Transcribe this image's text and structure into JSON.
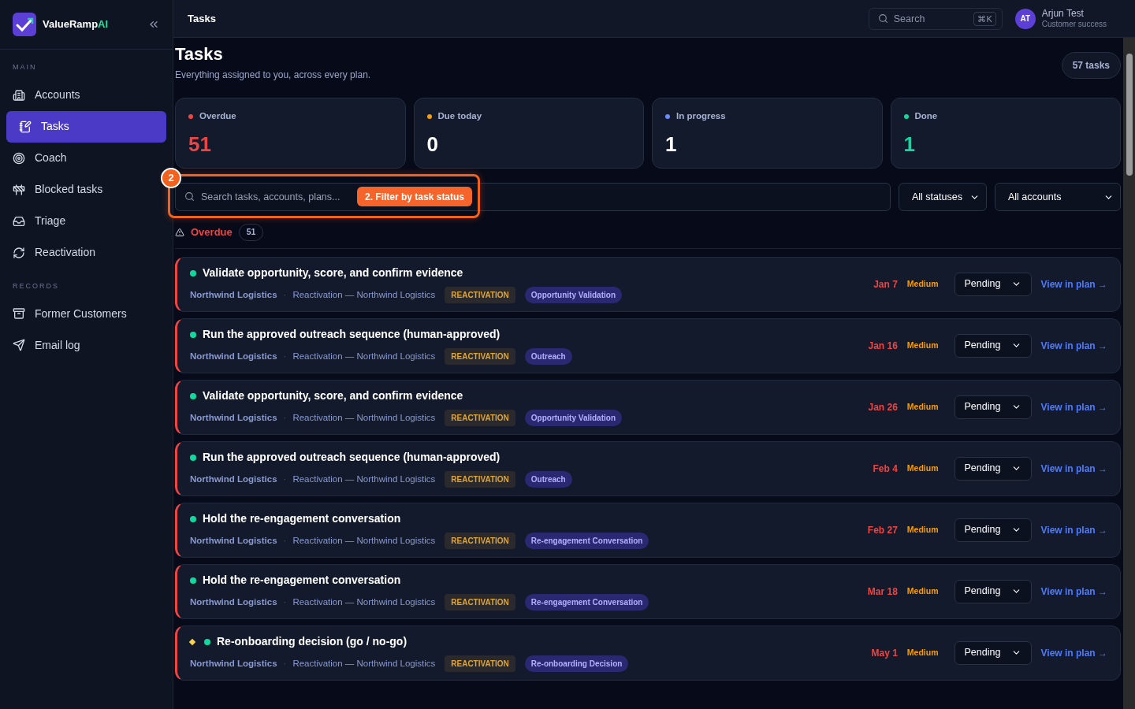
{
  "sidebar": {
    "brand": {
      "name": "ValueRamp",
      "accent": "AI"
    },
    "sections": [
      {
        "label": "MAIN",
        "items": [
          {
            "label": "Accounts",
            "selected": false
          },
          {
            "label": "Tasks",
            "selected": true
          },
          {
            "label": "Coach",
            "selected": false
          },
          {
            "label": "Blocked tasks",
            "selected": false
          },
          {
            "label": "Triage",
            "selected": false
          },
          {
            "label": "Reactivation",
            "selected": false
          }
        ]
      },
      {
        "label": "RECORDS",
        "items": [
          {
            "label": "Former Customers",
            "selected": false
          },
          {
            "label": "Email log",
            "selected": false
          }
        ]
      }
    ]
  },
  "header": {
    "title": "Tasks",
    "search": {
      "placeholder": "Search",
      "shortcut": "⌘K"
    },
    "user": {
      "initials": "AT",
      "name": "Arjun Test",
      "role": "Customer success"
    }
  },
  "page": {
    "title": "Tasks",
    "subtitle": "Everything assigned to you, across every plan.",
    "count": "57 tasks"
  },
  "stats": [
    {
      "label": "Overdue",
      "value": "51",
      "color": "#ef4444"
    },
    {
      "label": "Due today",
      "value": "0",
      "color": "#f59e0b"
    },
    {
      "label": "In progress",
      "value": "1",
      "color": "#6b8cff"
    },
    {
      "label": "Done",
      "value": "1",
      "color": "#10d9a0"
    }
  ],
  "filters": {
    "search": {
      "placeholder": "Search tasks, accounts, plans..."
    },
    "status": "All statuses",
    "account": "All accounts"
  },
  "tour": {
    "step": "2",
    "label": "2. Filter by task status"
  },
  "group": {
    "label": "Overdue",
    "count": "51"
  },
  "rows": [
    {
      "title": "Validate opportunity, score, and confirm evidence",
      "flagged": false,
      "account": "Northwind Logistics",
      "separator": "·",
      "plan": "Reactivation — Northwind Logistics",
      "tag": "REACTIVATION",
      "category": "Opportunity Validation",
      "due": "Jan 7",
      "priority": "Medium",
      "status": "Pending",
      "link": "View in plan →"
    },
    {
      "title": "Run the approved outreach sequence (human-approved)",
      "flagged": false,
      "account": "Northwind Logistics",
      "separator": "·",
      "plan": "Reactivation — Northwind Logistics",
      "tag": "REACTIVATION",
      "category": "Outreach",
      "due": "Jan 16",
      "priority": "Medium",
      "status": "Pending",
      "link": "View in plan →"
    },
    {
      "title": "Validate opportunity, score, and confirm evidence",
      "flagged": false,
      "account": "Northwind Logistics",
      "separator": "·",
      "plan": "Reactivation — Northwind Logistics",
      "tag": "REACTIVATION",
      "category": "Opportunity Validation",
      "due": "Jan 26",
      "priority": "Medium",
      "status": "Pending",
      "link": "View in plan →"
    },
    {
      "title": "Run the approved outreach sequence (human-approved)",
      "flagged": false,
      "account": "Northwind Logistics",
      "separator": "·",
      "plan": "Reactivation — Northwind Logistics",
      "tag": "REACTIVATION",
      "category": "Outreach",
      "due": "Feb 4",
      "priority": "Medium",
      "status": "Pending",
      "link": "View in plan →"
    },
    {
      "title": "Hold the re-engagement conversation",
      "flagged": false,
      "account": "Northwind Logistics",
      "separator": "·",
      "plan": "Reactivation — Northwind Logistics",
      "tag": "REACTIVATION",
      "category": "Re-engagement Conversation",
      "due": "Feb 27",
      "priority": "Medium",
      "status": "Pending",
      "link": "View in plan →"
    },
    {
      "title": "Hold the re-engagement conversation",
      "flagged": false,
      "account": "Northwind Logistics",
      "separator": "·",
      "plan": "Reactivation — Northwind Logistics",
      "tag": "REACTIVATION",
      "category": "Re-engagement Conversation",
      "due": "Mar 18",
      "priority": "Medium",
      "status": "Pending",
      "link": "View in plan →"
    },
    {
      "title": "Re-onboarding decision (go / no-go)",
      "flagged": true,
      "account": "Northwind Logistics",
      "separator": "·",
      "plan": "Reactivation — Northwind Logistics",
      "tag": "REACTIVATION",
      "category": "Re-onboarding Decision",
      "due": "May 1",
      "priority": "Medium",
      "status": "Pending",
      "link": "View in plan →"
    }
  ]
}
